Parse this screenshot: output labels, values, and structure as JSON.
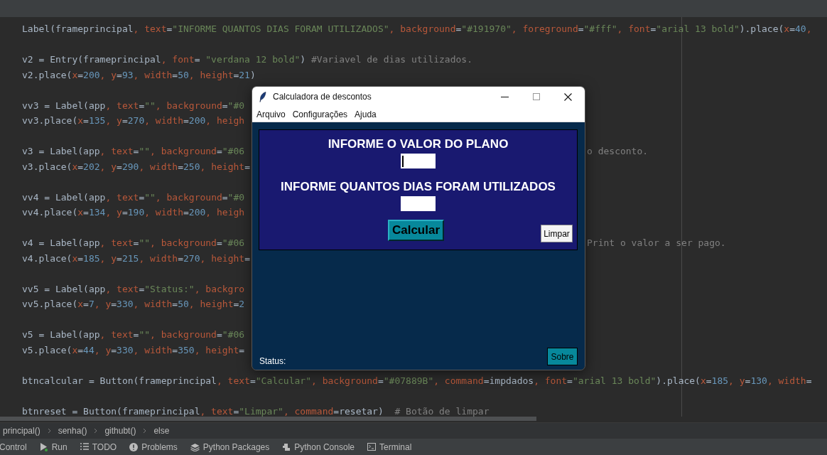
{
  "editor": {
    "lines": [
      {
        "kind": "code",
        "tokens": [
          {
            "kind": "plain",
            "text": "Label(frameprincipal"
          },
          {
            "kind": "param",
            "text": ", text"
          },
          {
            "kind": "plain",
            "text": "="
          },
          {
            "kind": "string",
            "text": "\"INFORME QUANTOS DIAS FORAM UTILIZADOS\""
          },
          {
            "kind": "param",
            "text": ", background"
          },
          {
            "kind": "plain",
            "text": "="
          },
          {
            "kind": "string",
            "text": "\"#191970\""
          },
          {
            "kind": "param",
            "text": ", foreground"
          },
          {
            "kind": "plain",
            "text": "="
          },
          {
            "kind": "string",
            "text": "\"#fff\""
          },
          {
            "kind": "param",
            "text": ", font"
          },
          {
            "kind": "plain",
            "text": "="
          },
          {
            "kind": "string",
            "text": "\"arial 13 bold\""
          },
          {
            "kind": "plain",
            "text": ").place("
          },
          {
            "kind": "param",
            "text": "x"
          },
          {
            "kind": "plain",
            "text": "="
          },
          {
            "kind": "number",
            "text": "40"
          },
          {
            "kind": "param",
            "text": ","
          }
        ]
      },
      {
        "kind": "blank"
      },
      {
        "kind": "code",
        "tokens": [
          {
            "kind": "plain",
            "text": "v2 = Entry(frameprincipal"
          },
          {
            "kind": "param",
            "text": ", font"
          },
          {
            "kind": "plain",
            "text": "= "
          },
          {
            "kind": "string",
            "text": "\"verdana 12 bold\""
          },
          {
            "kind": "plain",
            "text": ") "
          },
          {
            "kind": "comment",
            "text": "#Variavel de dias utilizados."
          }
        ]
      },
      {
        "kind": "code",
        "tokens": [
          {
            "kind": "plain",
            "text": "v2.place("
          },
          {
            "kind": "param",
            "text": "x"
          },
          {
            "kind": "plain",
            "text": "="
          },
          {
            "kind": "number",
            "text": "200"
          },
          {
            "kind": "param",
            "text": ", y"
          },
          {
            "kind": "plain",
            "text": "="
          },
          {
            "kind": "number",
            "text": "93"
          },
          {
            "kind": "param",
            "text": ", width"
          },
          {
            "kind": "plain",
            "text": "="
          },
          {
            "kind": "number",
            "text": "50"
          },
          {
            "kind": "param",
            "text": ", height"
          },
          {
            "kind": "plain",
            "text": "="
          },
          {
            "kind": "number",
            "text": "21"
          },
          {
            "kind": "plain",
            "text": ")"
          }
        ]
      },
      {
        "kind": "blank"
      },
      {
        "kind": "code",
        "tokens": [
          {
            "kind": "plain",
            "text": "vv3 = Label(app"
          },
          {
            "kind": "param",
            "text": ", text"
          },
          {
            "kind": "plain",
            "text": "="
          },
          {
            "kind": "string",
            "text": "\"\""
          },
          {
            "kind": "param",
            "text": ", background"
          },
          {
            "kind": "plain",
            "text": "="
          },
          {
            "kind": "string",
            "text": "\"#0"
          }
        ]
      },
      {
        "kind": "code",
        "tokens": [
          {
            "kind": "plain",
            "text": "vv3.place("
          },
          {
            "kind": "param",
            "text": "x"
          },
          {
            "kind": "plain",
            "text": "="
          },
          {
            "kind": "number",
            "text": "135"
          },
          {
            "kind": "param",
            "text": ", y"
          },
          {
            "kind": "plain",
            "text": "="
          },
          {
            "kind": "number",
            "text": "270"
          },
          {
            "kind": "param",
            "text": ", width"
          },
          {
            "kind": "plain",
            "text": "="
          },
          {
            "kind": "number",
            "text": "200"
          },
          {
            "kind": "param",
            "text": ", heigh"
          }
        ]
      },
      {
        "kind": "blank"
      },
      {
        "kind": "code",
        "tokens": [
          {
            "kind": "plain",
            "text": "v3 = Label(app"
          },
          {
            "kind": "param",
            "text": ", text"
          },
          {
            "kind": "plain",
            "text": "="
          },
          {
            "kind": "string",
            "text": "\"\""
          },
          {
            "kind": "param",
            "text": ", background"
          },
          {
            "kind": "plain",
            "text": "="
          },
          {
            "kind": "string",
            "text": "\"#06"
          }
        ],
        "tail": "o desconto."
      },
      {
        "kind": "code",
        "tokens": [
          {
            "kind": "plain",
            "text": "v3.place("
          },
          {
            "kind": "param",
            "text": "x"
          },
          {
            "kind": "plain",
            "text": "="
          },
          {
            "kind": "number",
            "text": "202"
          },
          {
            "kind": "param",
            "text": ", y"
          },
          {
            "kind": "plain",
            "text": "="
          },
          {
            "kind": "number",
            "text": "290"
          },
          {
            "kind": "param",
            "text": ", width"
          },
          {
            "kind": "plain",
            "text": "="
          },
          {
            "kind": "number",
            "text": "250"
          },
          {
            "kind": "param",
            "text": ", height"
          },
          {
            "kind": "plain",
            "text": "="
          }
        ]
      },
      {
        "kind": "blank"
      },
      {
        "kind": "code",
        "tokens": [
          {
            "kind": "plain",
            "text": "vv4 = Label(app"
          },
          {
            "kind": "param",
            "text": ", text"
          },
          {
            "kind": "plain",
            "text": "="
          },
          {
            "kind": "string",
            "text": "\"\""
          },
          {
            "kind": "param",
            "text": ", background"
          },
          {
            "kind": "plain",
            "text": "="
          },
          {
            "kind": "string",
            "text": "\"#0"
          }
        ]
      },
      {
        "kind": "code",
        "tokens": [
          {
            "kind": "plain",
            "text": "vv4.place("
          },
          {
            "kind": "param",
            "text": "x"
          },
          {
            "kind": "plain",
            "text": "="
          },
          {
            "kind": "number",
            "text": "134"
          },
          {
            "kind": "param",
            "text": ", y"
          },
          {
            "kind": "plain",
            "text": "="
          },
          {
            "kind": "number",
            "text": "190"
          },
          {
            "kind": "param",
            "text": ", width"
          },
          {
            "kind": "plain",
            "text": "="
          },
          {
            "kind": "number",
            "text": "200"
          },
          {
            "kind": "param",
            "text": ", heigh"
          }
        ]
      },
      {
        "kind": "blank"
      },
      {
        "kind": "code",
        "tokens": [
          {
            "kind": "plain",
            "text": "v4 = Label(app"
          },
          {
            "kind": "param",
            "text": ", text"
          },
          {
            "kind": "plain",
            "text": "="
          },
          {
            "kind": "string",
            "text": "\"\""
          },
          {
            "kind": "param",
            "text": ", background"
          },
          {
            "kind": "plain",
            "text": "="
          },
          {
            "kind": "string",
            "text": "\"#06"
          }
        ],
        "tail": "Print o valor a ser pago."
      },
      {
        "kind": "code",
        "tokens": [
          {
            "kind": "plain",
            "text": "v4.place("
          },
          {
            "kind": "param",
            "text": "x"
          },
          {
            "kind": "plain",
            "text": "="
          },
          {
            "kind": "number",
            "text": "185"
          },
          {
            "kind": "param",
            "text": ", y"
          },
          {
            "kind": "plain",
            "text": "="
          },
          {
            "kind": "number",
            "text": "215"
          },
          {
            "kind": "param",
            "text": ", width"
          },
          {
            "kind": "plain",
            "text": "="
          },
          {
            "kind": "number",
            "text": "270"
          },
          {
            "kind": "param",
            "text": ", height"
          },
          {
            "kind": "plain",
            "text": "="
          }
        ]
      },
      {
        "kind": "blank"
      },
      {
        "kind": "code",
        "tokens": [
          {
            "kind": "plain",
            "text": "vv5 = Label(app"
          },
          {
            "kind": "param",
            "text": ", text"
          },
          {
            "kind": "plain",
            "text": "="
          },
          {
            "kind": "string",
            "text": "\"Status:\""
          },
          {
            "kind": "param",
            "text": ", backgro"
          }
        ]
      },
      {
        "kind": "code",
        "tokens": [
          {
            "kind": "plain",
            "text": "vv5.place("
          },
          {
            "kind": "param",
            "text": "x"
          },
          {
            "kind": "plain",
            "text": "="
          },
          {
            "kind": "number",
            "text": "7"
          },
          {
            "kind": "param",
            "text": ", y"
          },
          {
            "kind": "plain",
            "text": "="
          },
          {
            "kind": "number",
            "text": "330"
          },
          {
            "kind": "param",
            "text": ", width"
          },
          {
            "kind": "plain",
            "text": "="
          },
          {
            "kind": "number",
            "text": "50"
          },
          {
            "kind": "param",
            "text": ", height"
          },
          {
            "kind": "plain",
            "text": "="
          },
          {
            "kind": "number",
            "text": "2"
          }
        ]
      },
      {
        "kind": "blank"
      },
      {
        "kind": "code",
        "tokens": [
          {
            "kind": "plain",
            "text": "v5 = Label(app"
          },
          {
            "kind": "param",
            "text": ", text"
          },
          {
            "kind": "plain",
            "text": "="
          },
          {
            "kind": "string",
            "text": "\"\""
          },
          {
            "kind": "param",
            "text": ", background"
          },
          {
            "kind": "plain",
            "text": "="
          },
          {
            "kind": "string",
            "text": "\"#06"
          }
        ]
      },
      {
        "kind": "code",
        "tokens": [
          {
            "kind": "plain",
            "text": "v5.place("
          },
          {
            "kind": "param",
            "text": "x"
          },
          {
            "kind": "plain",
            "text": "="
          },
          {
            "kind": "number",
            "text": "44"
          },
          {
            "kind": "param",
            "text": ", y"
          },
          {
            "kind": "plain",
            "text": "="
          },
          {
            "kind": "number",
            "text": "330"
          },
          {
            "kind": "param",
            "text": ", width"
          },
          {
            "kind": "plain",
            "text": "="
          },
          {
            "kind": "number",
            "text": "350"
          },
          {
            "kind": "param",
            "text": ", height"
          },
          {
            "kind": "plain",
            "text": "="
          }
        ]
      },
      {
        "kind": "blank"
      },
      {
        "kind": "code",
        "tokens": [
          {
            "kind": "plain",
            "text": "btncalcular = Button(frameprincipal"
          },
          {
            "kind": "param",
            "text": ", text"
          },
          {
            "kind": "plain",
            "text": "="
          },
          {
            "kind": "string",
            "text": "\"Calcular\""
          },
          {
            "kind": "param",
            "text": ", background"
          },
          {
            "kind": "plain",
            "text": "="
          },
          {
            "kind": "string",
            "text": "\"#07889B\""
          },
          {
            "kind": "param",
            "text": ", command"
          },
          {
            "kind": "plain",
            "text": "=impdados"
          },
          {
            "kind": "param",
            "text": ", font"
          },
          {
            "kind": "plain",
            "text": "="
          },
          {
            "kind": "string",
            "text": "\"arial 13 bold\""
          },
          {
            "kind": "plain",
            "text": ").place("
          },
          {
            "kind": "param",
            "text": "x"
          },
          {
            "kind": "plain",
            "text": "="
          },
          {
            "kind": "number",
            "text": "185"
          },
          {
            "kind": "param",
            "text": ", y"
          },
          {
            "kind": "plain",
            "text": "="
          },
          {
            "kind": "number",
            "text": "130"
          },
          {
            "kind": "param",
            "text": ", width"
          },
          {
            "kind": "plain",
            "text": "="
          }
        ]
      },
      {
        "kind": "blank"
      },
      {
        "kind": "code",
        "tokens": [
          {
            "kind": "plain",
            "text": "btnreset = Button(frameprincipal"
          },
          {
            "kind": "param",
            "text": ", text"
          },
          {
            "kind": "plain",
            "text": "="
          },
          {
            "kind": "string",
            "text": "\"Limpar\""
          },
          {
            "kind": "param",
            "text": ", command"
          },
          {
            "kind": "plain",
            "text": "=resetar)  "
          },
          {
            "kind": "comment",
            "text": "# Botão de limpar"
          }
        ]
      }
    ]
  },
  "dialog": {
    "title": "Calculadora de descontos",
    "menu": [
      "Arquivo",
      "Configurações",
      "Ajuda"
    ],
    "rows": [
      {
        "label": "INFORME O VALOR DO PLANO",
        "focused": true
      },
      {
        "label": "INFORME QUANTOS DIAS FORAM UTILIZADOS",
        "focused": false
      }
    ],
    "buttons": [
      {
        "kind": "primary",
        "label": "Calcular"
      },
      {
        "kind": "secondary",
        "label": "Limpar"
      }
    ],
    "status_label": "Status:",
    "about_button": "Sobre"
  },
  "breadcrumbs": [
    "principal()",
    "senha()",
    "githubt()",
    "else"
  ],
  "tool_windows": [
    {
      "kind": "control",
      "label": "Control"
    },
    {
      "kind": "run",
      "label": "Run"
    },
    {
      "kind": "todo",
      "label": "TODO"
    },
    {
      "kind": "problems",
      "label": "Problems"
    },
    {
      "kind": "packages",
      "label": "Python Packages"
    },
    {
      "kind": "console",
      "label": "Python Console"
    },
    {
      "kind": "terminal",
      "label": "Terminal"
    }
  ]
}
